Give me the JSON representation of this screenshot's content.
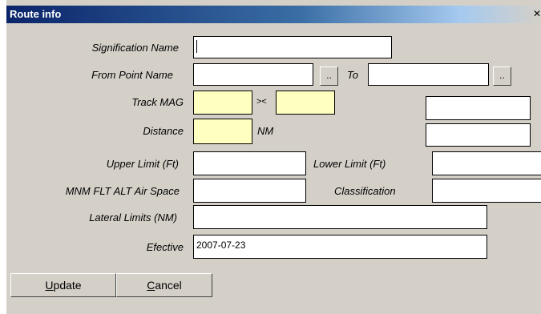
{
  "window": {
    "title": "Route info",
    "close_glyph": "✕"
  },
  "form": {
    "signification_name": {
      "label": "Signification Name",
      "value": ""
    },
    "from_point_name": {
      "label": "From Point Name",
      "value": "",
      "browse": ".."
    },
    "to_point": {
      "label": "To",
      "value": "",
      "browse": ".."
    },
    "track_mag": {
      "label": "Track MAG",
      "value": "",
      "separator": "><",
      "value2": "",
      "aux_value": ""
    },
    "distance": {
      "label": "Distance",
      "value": "",
      "unit": "NM",
      "aux_value": ""
    },
    "upper_limit": {
      "label": "Upper Limit (Ft)",
      "value": ""
    },
    "lower_limit": {
      "label": "Lower Limit (Ft)",
      "value": ""
    },
    "mnm_flt_alt": {
      "label": "MNM FLT ALT Air Space",
      "value": ""
    },
    "classification": {
      "label": "Classification",
      "value": ""
    },
    "lateral_limits": {
      "label": "Lateral Limits (NM)",
      "value": ""
    },
    "efective": {
      "label": "Efective",
      "value": "2007-07-23"
    }
  },
  "buttons": {
    "update": {
      "mnemonic": "U",
      "rest": "pdate"
    },
    "cancel": {
      "mnemonic": "C",
      "rest": "ancel"
    }
  },
  "colors": {
    "dialog_bg": "#d4d0c8",
    "title_bg": "#0a246a",
    "required_field": "#ffffc0"
  }
}
